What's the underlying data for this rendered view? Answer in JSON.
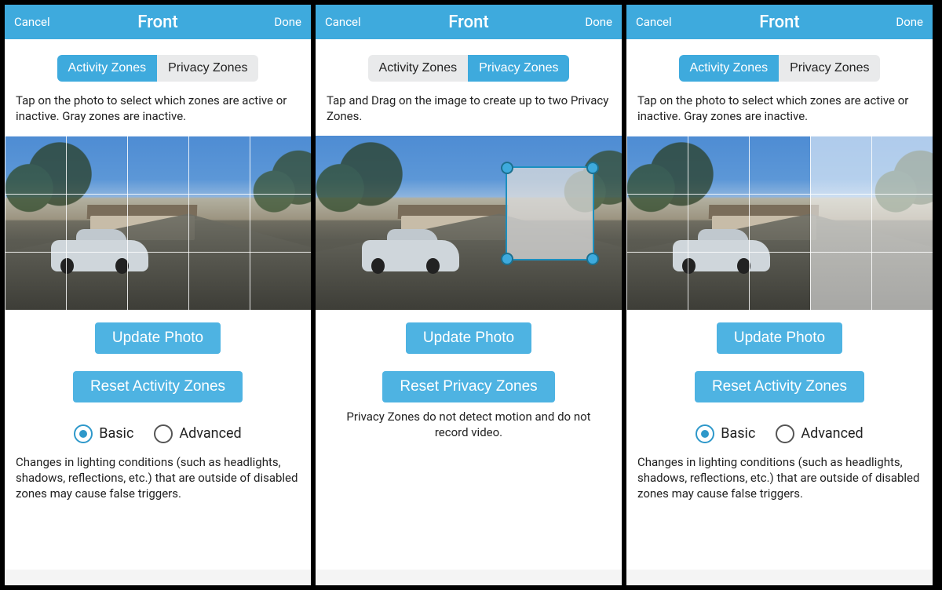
{
  "header": {
    "cancel": "Cancel",
    "title": "Front",
    "done": "Done"
  },
  "tabs": {
    "activity": "Activity Zones",
    "privacy": "Privacy Zones"
  },
  "instructions": {
    "activity": "Tap on the photo to select which zones are active or inactive. Gray zones are inactive.",
    "privacy": "Tap and Drag on the image to create up to two Privacy Zones."
  },
  "buttons": {
    "update": "Update Photo",
    "reset_activity": "Reset Activity Zones",
    "reset_privacy": "Reset Privacy Zones"
  },
  "notes": {
    "privacy": "Privacy Zones do not detect motion and do not record video.",
    "activity": "Changes in lighting conditions (such as headlights, shadows, reflections, etc.) that are outside of disabled zones may cause false triggers."
  },
  "radio": {
    "basic": "Basic",
    "advanced": "Advanced",
    "selected": "basic"
  },
  "grid": {
    "cols": 5,
    "rows": 3
  },
  "panes": {
    "left": {
      "inactive_cells": []
    },
    "right": {
      "inactive_cells": [
        {
          "col": 3,
          "row": 0
        },
        {
          "col": 4,
          "row": 0
        },
        {
          "col": 3,
          "row": 1
        },
        {
          "col": 4,
          "row": 1
        },
        {
          "col": 3,
          "row": 2
        },
        {
          "col": 4,
          "row": 2
        }
      ]
    }
  }
}
